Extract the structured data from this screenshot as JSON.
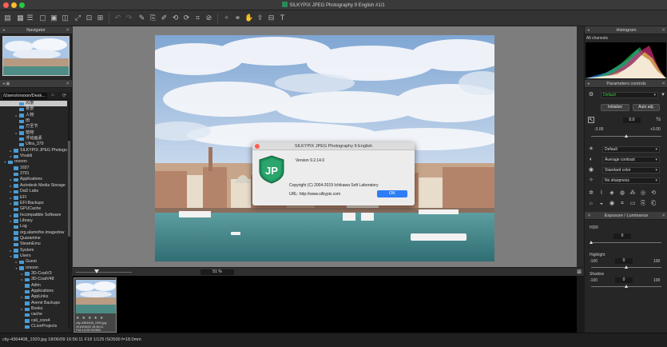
{
  "window": {
    "title": "SILKYPIX JPEG Photography 9 English   #1/1",
    "traffic_colors": [
      "#fc5f57",
      "#fdbc2e",
      "#28c840"
    ]
  },
  "left_panel": {
    "navigator_title": "Navigator",
    "path": "/Users/orsoon/Desk...",
    "tree": [
      {
        "indent": 2,
        "arrow": "",
        "label": "风景",
        "selected": true
      },
      {
        "indent": 2,
        "arrow": "",
        "label": "夜景",
        "selected": false
      },
      {
        "indent": 2,
        "arrow": "▸",
        "label": "人物",
        "selected": false
      },
      {
        "indent": 2,
        "arrow": "",
        "label": "田",
        "selected": false
      },
      {
        "indent": 2,
        "arrow": "",
        "label": "万圣节",
        "selected": false
      },
      {
        "indent": 2,
        "arrow": "▸",
        "label": "植物",
        "selected": false
      },
      {
        "indent": 2,
        "arrow": "",
        "label": "浮动画素",
        "selected": false
      },
      {
        "indent": 2,
        "arrow": "",
        "label": "Ultra_379",
        "selected": false
      },
      {
        "indent": 1,
        "arrow": "▸",
        "label": "SILKYPIX JPEG Photograph",
        "selected": false
      },
      {
        "indent": 1,
        "arrow": "▸",
        "label": "Vivaldi",
        "selected": false
      },
      {
        "indent": 0,
        "arrow": "▾",
        "label": "orsoon",
        "selected": false
      },
      {
        "indent": 1,
        "arrow": "",
        "label": "1657",
        "selected": false
      },
      {
        "indent": 1,
        "arrow": "",
        "label": "3791",
        "selected": false
      },
      {
        "indent": 1,
        "arrow": "▸",
        "label": "Applications",
        "selected": false
      },
      {
        "indent": 1,
        "arrow": "▸",
        "label": "Autodesk Media Storage",
        "selected": false
      },
      {
        "indent": 1,
        "arrow": "▸",
        "label": "DaD Labs",
        "selected": false
      },
      {
        "indent": 1,
        "arrow": "▸",
        "label": "EFI",
        "selected": false
      },
      {
        "indent": 1,
        "arrow": "▸",
        "label": "EFI-Backups",
        "selected": false
      },
      {
        "indent": 1,
        "arrow": "",
        "label": "GPUCache",
        "selected": false
      },
      {
        "indent": 1,
        "arrow": "▸",
        "label": "Incompatible Software",
        "selected": false
      },
      {
        "indent": 1,
        "arrow": "▸",
        "label": "Library",
        "selected": false
      },
      {
        "indent": 1,
        "arrow": "",
        "label": "Log",
        "selected": false
      },
      {
        "indent": 1,
        "arrow": "",
        "label": "org.alamofire.imagedow",
        "selected": false
      },
      {
        "indent": 1,
        "arrow": "",
        "label": "Quarantine",
        "selected": false
      },
      {
        "indent": 1,
        "arrow": "",
        "label": "SteamEmu",
        "selected": false
      },
      {
        "indent": 1,
        "arrow": "▸",
        "label": "System",
        "selected": false
      },
      {
        "indent": 1,
        "arrow": "▾",
        "label": "Users",
        "selected": false
      },
      {
        "indent": 2,
        "arrow": "▸",
        "label": "Guest",
        "selected": false
      },
      {
        "indent": 2,
        "arrow": "▾",
        "label": "orsoon",
        "selected": false
      },
      {
        "indent": 3,
        "arrow": "▸",
        "label": "3D-CoatV3",
        "selected": false
      },
      {
        "indent": 3,
        "arrow": "▸",
        "label": "3D-CoatV48",
        "selected": false
      },
      {
        "indent": 3,
        "arrow": "",
        "label": "Adlm",
        "selected": false
      },
      {
        "indent": 3,
        "arrow": "",
        "label": "Applications",
        "selected": false
      },
      {
        "indent": 3,
        "arrow": "▸",
        "label": "AppLinks",
        "selected": false
      },
      {
        "indent": 3,
        "arrow": "",
        "label": "Avenir Backups",
        "selected": false
      },
      {
        "indent": 3,
        "arrow": "▸",
        "label": "Books",
        "selected": false
      },
      {
        "indent": 3,
        "arrow": "",
        "label": "cache",
        "selected": false
      },
      {
        "indent": 3,
        "arrow": "",
        "label": "cali_core4",
        "selected": false
      },
      {
        "indent": 3,
        "arrow": "",
        "label": "CLionProjects",
        "selected": false
      }
    ]
  },
  "center": {
    "zoom_value": "51 %",
    "thumb_stars": "★ ★ ★ ★ ★",
    "thumb_caption_line1": "city-4364408_1920.jpg",
    "thumb_caption_line2": "2018/08/20 16:56:11",
    "thumb_caption_line3": "F18 1/125 ISO500"
  },
  "dialog": {
    "title": "SILKYPIX JPEG Photography 9 English",
    "logo_text": "JP",
    "version": "Version 9.2.14.0",
    "copyright": "Copyright (C) 2004-2019 Ichikawa Soft Laboratory",
    "url": "URL: http://www.silkypix.com",
    "ok_label": "OK",
    "logo_color": "#1e8f5a"
  },
  "right_panel": {
    "histogram_title": "Histogram",
    "histogram_channel": "All channels",
    "params_title": "Parameters controls",
    "preset": "Default",
    "initialize_label": "Initialize",
    "auto_adj_label": "Auto adj.",
    "exposure_value": "0.0",
    "exposure_min": "-3.00",
    "exposure_max": "+3.00",
    "tone_preset": "Default",
    "contrast": "Average contrast",
    "color": "Standard color",
    "sharpness": "No sharpness",
    "exposure_section_title": "Exposure / Luminance",
    "hdr_label": "HDR",
    "hdr_value": "0",
    "highlight_label": "Highlight",
    "highlight_min": "-100",
    "highlight_value": "0",
    "highlight_max": "100",
    "shadow_label": "Shadow",
    "shadow_min": "-100",
    "shadow_value": "0",
    "shadow_max": "100",
    "accent_green": "#3cc83c"
  },
  "status": {
    "text": "city-4364408_1920.jpg 18/06/09 16:56:11 F18 1/125 ISO500 f=18.0mm"
  }
}
